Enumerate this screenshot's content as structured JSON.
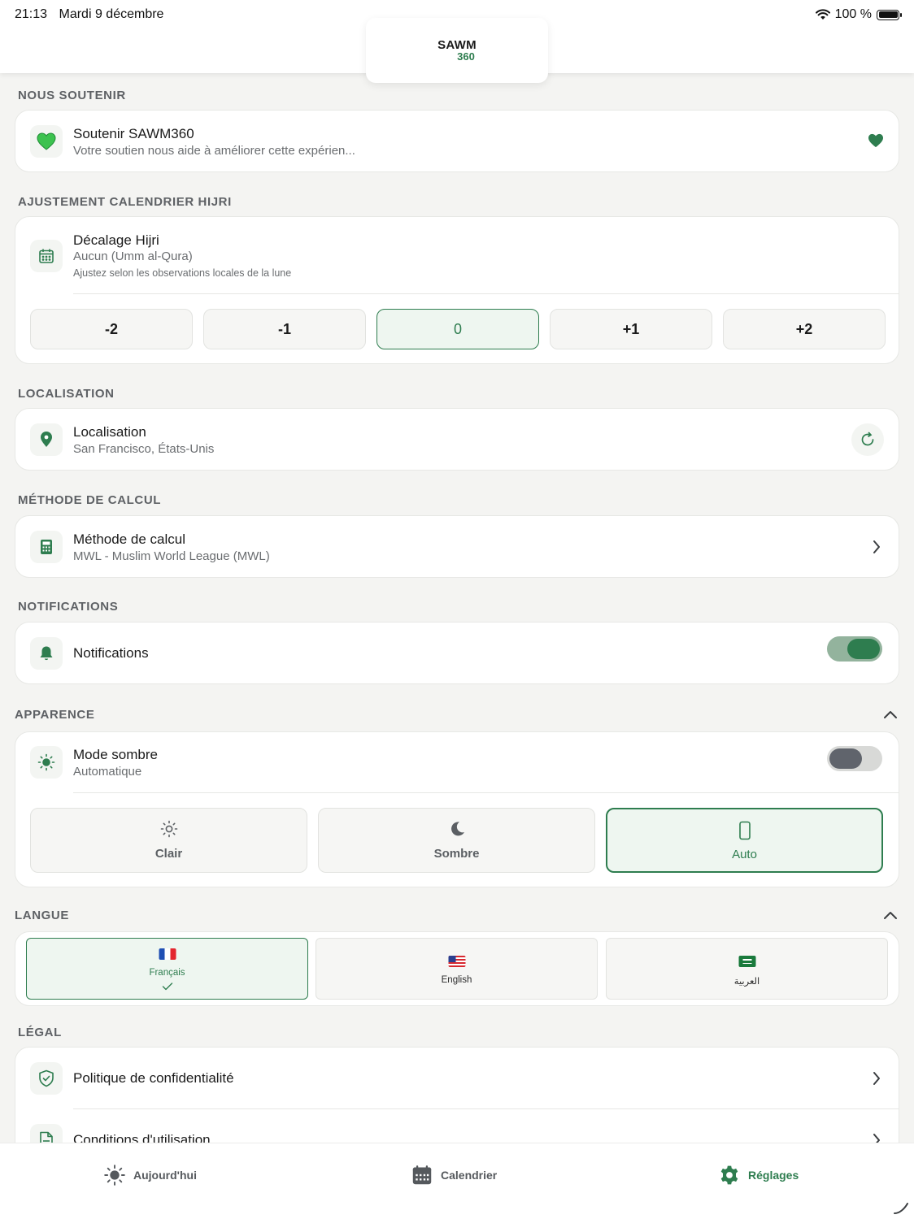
{
  "status_bar": {
    "time": "21:13",
    "date": "Mardi 9 décembre",
    "battery": "100 %"
  },
  "logo": {
    "top": "SAWM",
    "bottom": "360"
  },
  "sections": {
    "support": "NOUS SOUTENIR",
    "hijri": "AJUSTEMENT CALENDRIER HIJRI",
    "location": "LOCALISATION",
    "method": "MÉTHODE DE CALCUL",
    "notifications": "NOTIFICATIONS",
    "appearance": "APPARENCE",
    "language": "LANGUE",
    "legal": "LÉGAL"
  },
  "support": {
    "title": "Soutenir SAWM360",
    "subtitle": "Votre soutien nous aide à améliorer cette expérien..."
  },
  "hijri": {
    "title": "Décalage Hijri",
    "subtitle": "Aucun (Umm al-Qura)",
    "note": "Ajustez selon les observations locales de la lune",
    "options": [
      "-2",
      "-1",
      "0",
      "+1",
      "+2"
    ],
    "selected": "0"
  },
  "location": {
    "title": "Localisation",
    "subtitle": "San Francisco, États-Unis"
  },
  "method": {
    "title": "Méthode de calcul",
    "subtitle": "MWL - Muslim World League (MWL)"
  },
  "notifications": {
    "title": "Notifications",
    "enabled": true
  },
  "appearance": {
    "title": "Mode sombre",
    "subtitle": "Automatique",
    "dark_mode_toggle": false,
    "options": [
      {
        "label": "Clair",
        "icon": "sun-icon"
      },
      {
        "label": "Sombre",
        "icon": "moon-icon"
      },
      {
        "label": "Auto",
        "icon": "phone-icon"
      }
    ],
    "selected": "Auto"
  },
  "language": {
    "options": [
      {
        "label": "Français",
        "flag": "france-flag"
      },
      {
        "label": "English",
        "flag": "us-flag"
      },
      {
        "label": "العربية",
        "flag": "saudi-flag"
      }
    ],
    "selected": "Français"
  },
  "legal": {
    "privacy": "Politique de confidentialité",
    "terms": "Conditions d'utilisation"
  },
  "tabs": {
    "today": "Aujourd'hui",
    "calendar": "Calendrier",
    "settings": "Réglages",
    "active": "Réglages"
  },
  "colors": {
    "accent": "#2e7d4f",
    "background": "#f4f4f2",
    "card": "#ffffff",
    "section_title": "#5e6165"
  }
}
